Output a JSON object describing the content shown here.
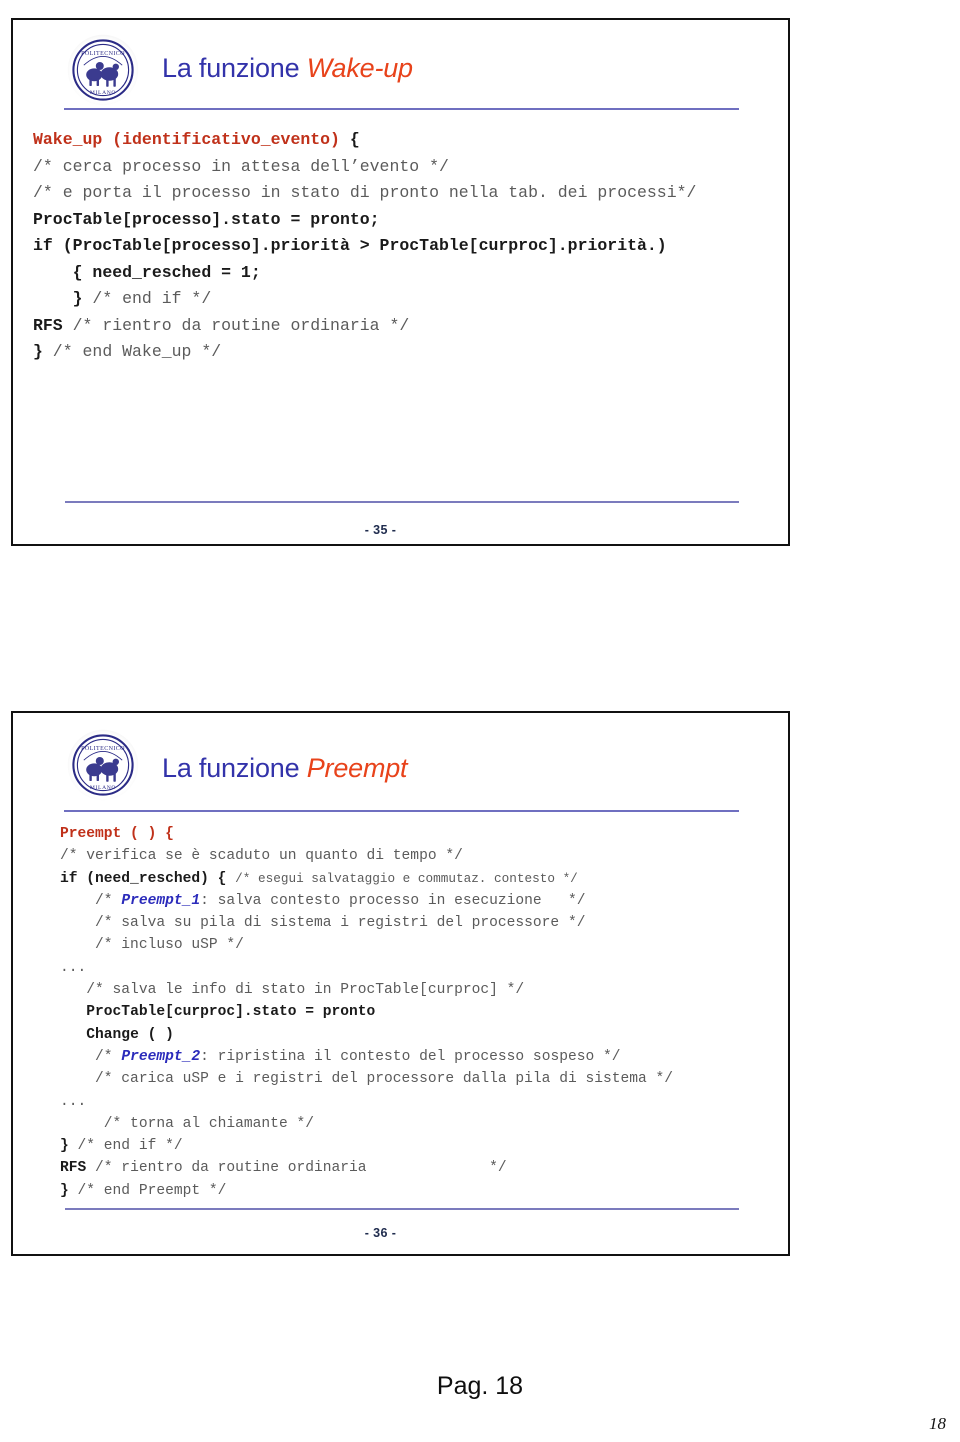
{
  "document": {
    "footer_label": "Pag. 18",
    "folio": "18"
  },
  "colors": {
    "title_primary": "#3333aa",
    "title_accent": "#e8431b",
    "code_comment": "#5b5b5b",
    "code_keyword": "#1a1a1a",
    "code_function": "#c0311a",
    "code_label": "#2b2bbb",
    "rule": "#6f6fc0",
    "slide_border": "#111111"
  },
  "slides": [
    {
      "id": "slide-1",
      "logo_icon": "politecnico-milano-logo-icon",
      "logo_text": "POLITECNICO MILANO",
      "title_prefix": "La funzione ",
      "title_accent": "Wake-up",
      "slide_number": "- 35 -",
      "code_lines": [
        "Wake_up (identificativo_evento) {",
        "/* cerca processo in attesa dell’evento */",
        "/* e porta il processo in stato di pronto nella tab. dei processi*/",
        "ProcTable[processo].stato = pronto;",
        "if (ProcTable[processo].priorità > ProcTable[curproc].priorità.)",
        "    { need_resched = 1;",
        "    } /* end if */",
        "RFS /* rientro da routine ordinaria */",
        "} /* end Wake_up */"
      ]
    },
    {
      "id": "slide-2",
      "logo_icon": "politecnico-milano-logo-icon",
      "logo_text": "POLITECNICO MILANO",
      "title_prefix": "La funzione ",
      "title_accent": "Preempt",
      "slide_number": "- 36 -",
      "code_lines": [
        "Preempt ( ) {",
        "/* verifica se è scaduto un quanto di tempo */",
        "if (need_resched) { /* esegui salvataggio e commutaz. contesto */",
        "    /* Preempt_1: salva contesto processo in esecuzione   */",
        "    /* salva su pila di sistema i registri del processore */",
        "    /* incluso uSP */",
        "    ...",
        "   /* salva le info di stato in ProcTable[curproc] */",
        "    ProcTable[curproc].stato = pronto",
        "    Change ( )",
        "    /* Preempt_2: ripristina il contesto del processo sospeso */",
        "    /* carica uSP e i registri del processore dalla pila di sistema */",
        "     ...",
        "     /* torna al chiamante */",
        "} /* end if */",
        "RFS /* rientro da routine ordinaria              */",
        "} /* end Preempt */"
      ]
    }
  ]
}
